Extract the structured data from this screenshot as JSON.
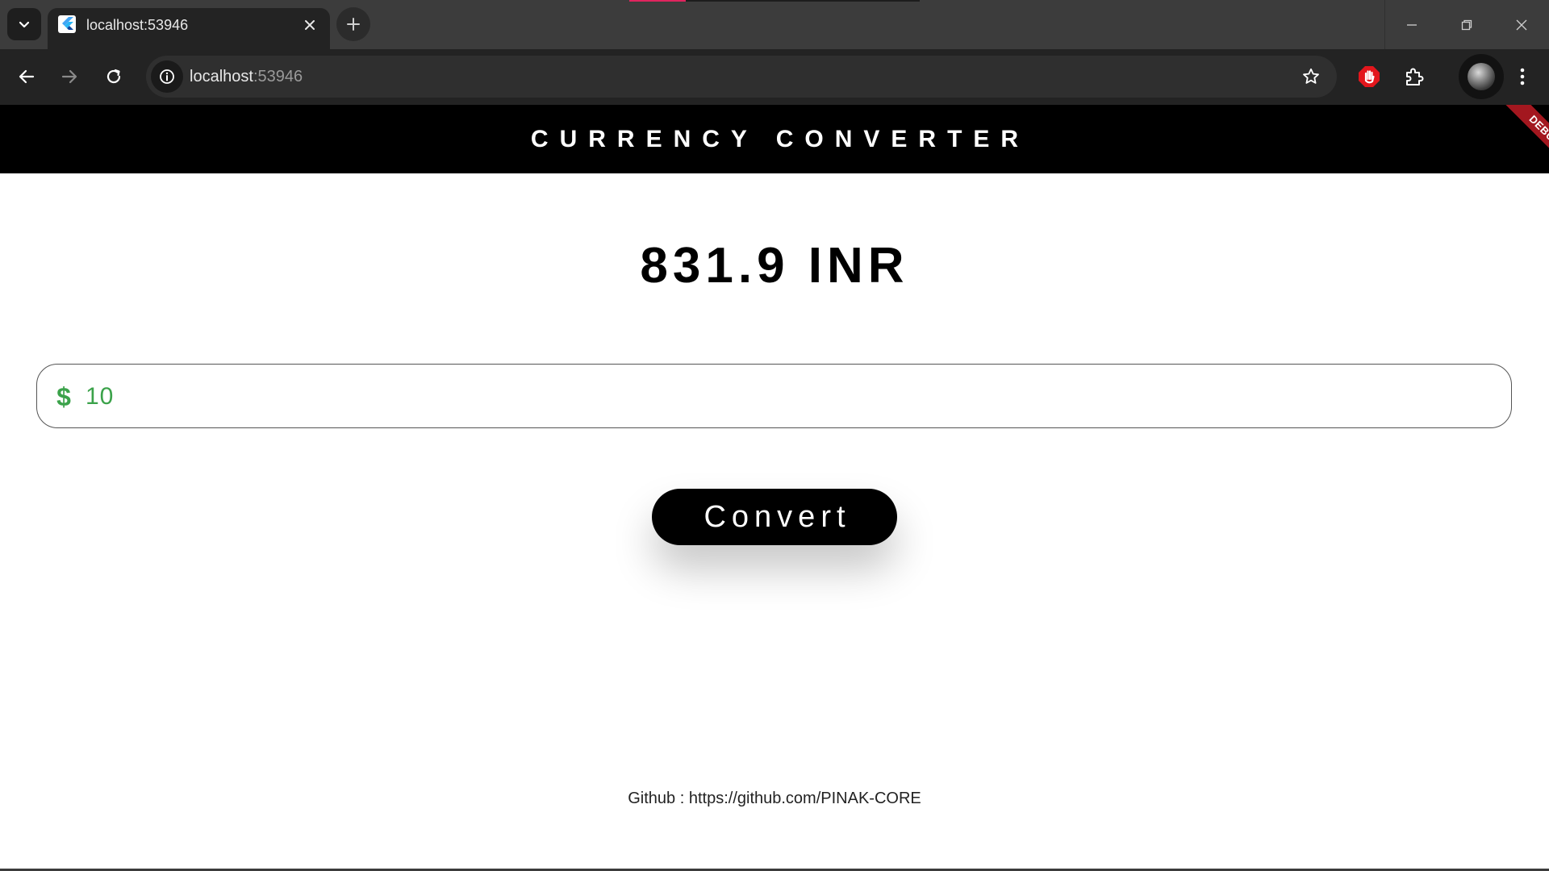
{
  "browser": {
    "tab": {
      "title": "localhost:53946"
    },
    "address": {
      "host": "localhost",
      "port": ":53946"
    }
  },
  "app": {
    "title": "CURRENCY CONVERTER",
    "debug_label": "DEBUG",
    "result": "831.9 INR",
    "amount_field": {
      "prefix": "$",
      "value": "10"
    },
    "convert_label": "Convert",
    "footer": "Github : https://github.com/PINAK-CORE"
  },
  "colors": {
    "appbar": "#000000",
    "accent_green": "#3ba24a",
    "debug_banner": "#a3171f"
  }
}
